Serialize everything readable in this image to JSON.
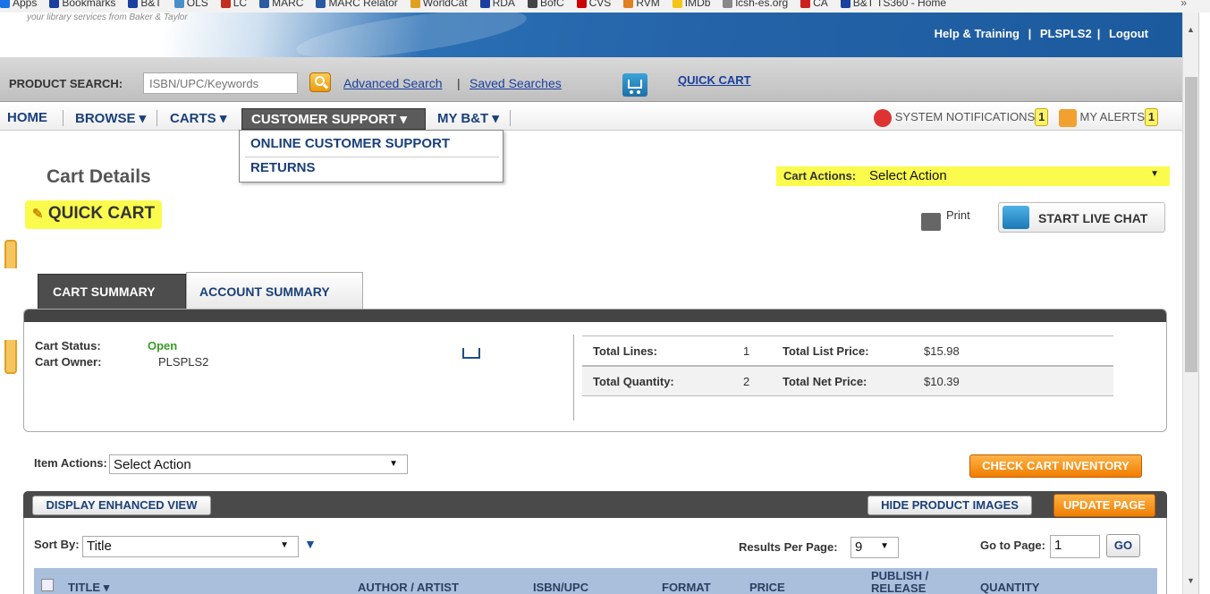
{
  "bookmarks": [
    {
      "label": "Apps",
      "icon": "apps-grid-icon",
      "color": "#1a73e8"
    },
    {
      "label": "Bookmarks",
      "icon": "star-icon",
      "color": "#1a3f9e"
    },
    {
      "label": "B&T",
      "icon": "bt-icon",
      "color": "#1a3f9e"
    },
    {
      "label": "OLS",
      "icon": "page-icon",
      "color": "#4a90c8"
    },
    {
      "label": "LC",
      "icon": "lc-icon",
      "color": "#c03020"
    },
    {
      "label": "MARC",
      "icon": "marc-icon",
      "color": "#2a5aa0"
    },
    {
      "label": "MARC Relator",
      "icon": "marc-icon",
      "color": "#2a5aa0"
    },
    {
      "label": "WorldCat",
      "icon": "worldcat-icon",
      "color": "#e0a020"
    },
    {
      "label": "RDA",
      "icon": "rda-icon",
      "color": "#1a3f9e"
    },
    {
      "label": "BofC",
      "icon": "bofc-icon",
      "color": "#444444"
    },
    {
      "label": "CVS",
      "icon": "cvs-icon",
      "color": "#cc0000"
    },
    {
      "label": "RVM",
      "icon": "rvm-icon",
      "color": "#e08020"
    },
    {
      "label": "IMDb",
      "icon": "imdb-icon",
      "color": "#f5c518"
    },
    {
      "label": "lcsh-es.org",
      "icon": "page-icon",
      "color": "#888888"
    },
    {
      "label": "CA",
      "icon": "ca-icon",
      "color": "#cc2020"
    },
    {
      "label": "B&T TS360 - Home",
      "icon": "bt-icon",
      "color": "#1a3f9e"
    }
  ],
  "bookmarks_more": "»",
  "header": {
    "tagline": "your library services from Baker & Taylor",
    "help": "Help & Training",
    "user": "PLSPLS2",
    "logout": "Logout",
    "sep": "|"
  },
  "search": {
    "label": "PRODUCT SEARCH:",
    "placeholder": "ISBN/UPC/Keywords",
    "advanced": "Advanced Search",
    "saved": "Saved Searches",
    "sep": "|",
    "quick_cart": "QUICK CART"
  },
  "nav": {
    "home": "HOME",
    "browse": "BROWSE ▾",
    "carts": "CARTS ▾",
    "support": "CUSTOMER SUPPORT ▾",
    "mybt": "MY B&T ▾",
    "system_notifications": "SYSTEM NOTIFICATIONS",
    "system_count": "1",
    "my_alerts": "MY ALERTS",
    "alerts_count": "1"
  },
  "dropdown": {
    "online_support": "ONLINE CUSTOMER SUPPORT",
    "returns": "RETURNS"
  },
  "page": {
    "title": "Cart Details",
    "cart_name": "QUICK CART",
    "cart_actions_label": "Cart Actions:",
    "cart_actions_value": "Select Action",
    "print": "Print",
    "live_chat": "START LIVE CHAT"
  },
  "tabs": {
    "cart_summary": "CART SUMMARY",
    "account_summary": "ACCOUNT SUMMARY"
  },
  "summary": {
    "status_label": "Cart Status:",
    "status_value": "Open",
    "owner_label": "Cart Owner:",
    "owner_value": "PLSPLS2",
    "total_lines_label": "Total Lines:",
    "total_lines": "1",
    "total_list_label": "Total List Price:",
    "total_list": "$15.98",
    "total_qty_label": "Total Quantity:",
    "total_qty": "2",
    "total_net_label": "Total Net Price:",
    "total_net": "$10.39"
  },
  "items": {
    "actions_label": "Item Actions:",
    "actions_value": "Select Action",
    "check_inventory": "CHECK CART INVENTORY",
    "enhanced_view": "DISPLAY ENHANCED VIEW",
    "hide_images": "HIDE PRODUCT IMAGES",
    "update_page": "UPDATE PAGE",
    "sort_label": "Sort By:",
    "sort_value": "Title",
    "results_label": "Results Per Page:",
    "results_value": "9",
    "goto_label": "Go to Page:",
    "goto_value": "1",
    "go": "GO"
  },
  "columns": {
    "title": "TITLE ▾",
    "author": "AUTHOR / ARTIST",
    "isbn": "ISBN/UPC",
    "format": "FORMAT",
    "price": "PRICE",
    "publish_1": "PUBLISH /",
    "publish_2": "RELEASE",
    "quantity": "QUANTITY"
  }
}
